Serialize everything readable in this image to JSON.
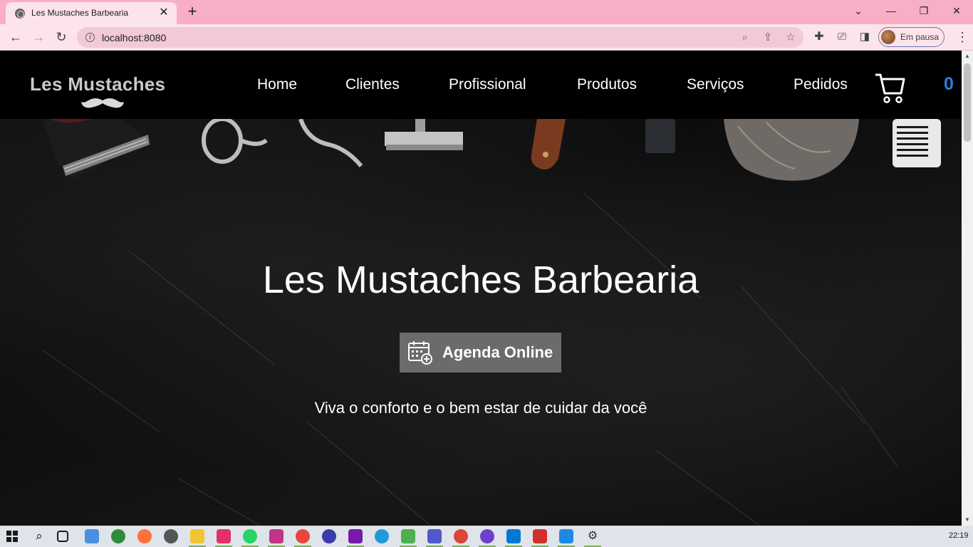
{
  "browser": {
    "tab_title": "Les Mustaches Barbearia",
    "tab_close": "✕",
    "new_tab": "+",
    "url": "localhost:8080",
    "profile_label": "Em pausa",
    "back": "←",
    "forward": "→",
    "reload": "↻"
  },
  "nav": {
    "logo_text": "Les Mustaches",
    "links": [
      "Home",
      "Clientes",
      "Profissional",
      "Produtos",
      "Serviços",
      "Pedidos"
    ],
    "cart_count": "0"
  },
  "hero": {
    "title": "Les Mustaches Barbearia",
    "button_label": "Agenda Online",
    "subtitle": "Viva o conforto e o bem estar de cuidar da você"
  },
  "taskbar": {
    "clock": "22:19"
  },
  "colors": {
    "tabstrip": "#f8aec5",
    "toolbar": "#fde3ea",
    "cart_count": "#2f7fd8",
    "agenda_button": "#6b6b6b"
  }
}
